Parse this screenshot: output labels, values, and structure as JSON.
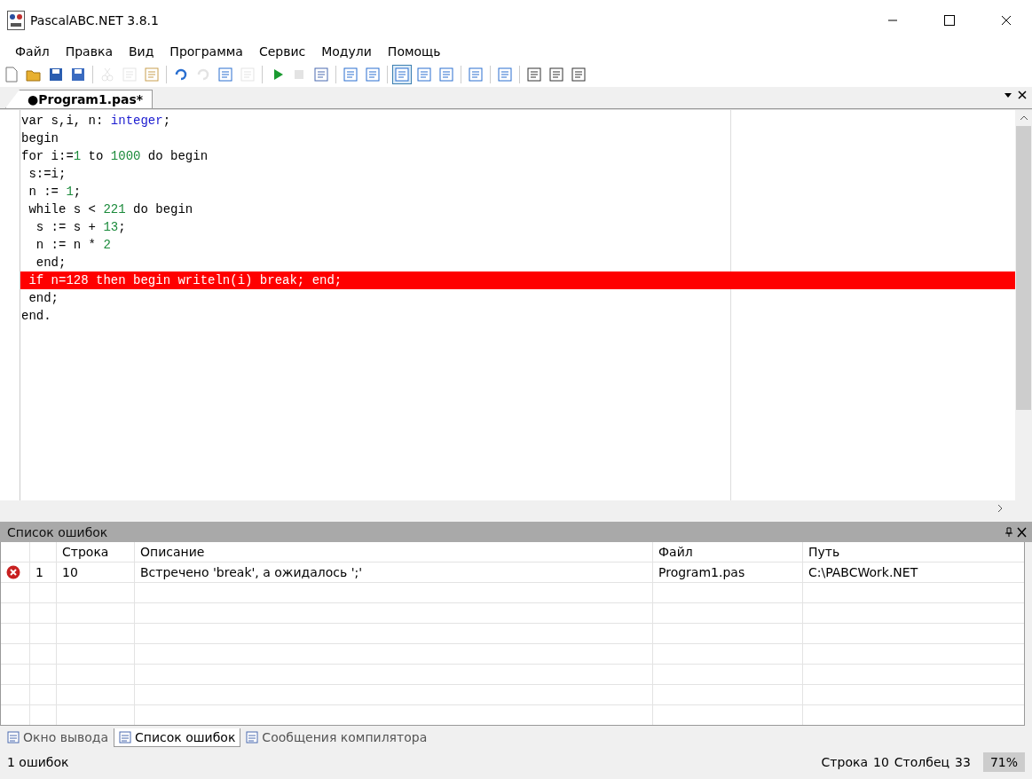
{
  "window": {
    "title": "PascalABC.NET 3.8.1"
  },
  "menu": [
    "Файл",
    "Правка",
    "Вид",
    "Программа",
    "Сервис",
    "Модули",
    "Помощь"
  ],
  "toolbar": [
    {
      "kind": "new",
      "disabled": false,
      "pressed": false
    },
    {
      "kind": "open",
      "disabled": false,
      "pressed": false
    },
    {
      "kind": "save",
      "disabled": false,
      "pressed": false
    },
    {
      "kind": "saveall",
      "disabled": false,
      "pressed": false
    },
    {
      "kind": "sep"
    },
    {
      "kind": "cut",
      "disabled": true,
      "pressed": false
    },
    {
      "kind": "copy",
      "disabled": true,
      "pressed": false
    },
    {
      "kind": "paste",
      "disabled": false,
      "pressed": false
    },
    {
      "kind": "sep"
    },
    {
      "kind": "undo",
      "disabled": false,
      "pressed": false
    },
    {
      "kind": "redo",
      "disabled": true,
      "pressed": false
    },
    {
      "kind": "back",
      "disabled": false,
      "pressed": false
    },
    {
      "kind": "forward",
      "disabled": true,
      "pressed": false
    },
    {
      "kind": "sep"
    },
    {
      "kind": "run",
      "disabled": false,
      "pressed": false
    },
    {
      "kind": "stop",
      "disabled": true,
      "pressed": false
    },
    {
      "kind": "build",
      "disabled": false,
      "pressed": false
    },
    {
      "kind": "sep"
    },
    {
      "kind": "stepin",
      "disabled": false,
      "pressed": false
    },
    {
      "kind": "stepover",
      "disabled": false,
      "pressed": false
    },
    {
      "kind": "sep"
    },
    {
      "kind": "console",
      "disabled": false,
      "pressed": true
    },
    {
      "kind": "cursor",
      "disabled": false,
      "pressed": false
    },
    {
      "kind": "abc",
      "disabled": false,
      "pressed": false
    },
    {
      "kind": "sep"
    },
    {
      "kind": "format",
      "disabled": false,
      "pressed": false
    },
    {
      "kind": "sep"
    },
    {
      "kind": "code",
      "disabled": false,
      "pressed": false
    },
    {
      "kind": "sep"
    },
    {
      "kind": "docd",
      "disabled": false,
      "pressed": false
    },
    {
      "kind": "docl",
      "disabled": false,
      "pressed": false
    },
    {
      "kind": "docr",
      "disabled": false,
      "pressed": false
    }
  ],
  "doc_tabs": [
    {
      "label": "●Program1.pas*",
      "selected": true
    }
  ],
  "code": [
    {
      "highlighted": false,
      "tokens": [
        {
          "t": "var s,i, n: ",
          "kind": "plain"
        },
        {
          "t": "integer",
          "kind": "type"
        },
        {
          "t": ";",
          "kind": "plain"
        }
      ]
    },
    {
      "highlighted": false,
      "tokens": [
        {
          "t": "begin",
          "kind": "plain"
        }
      ]
    },
    {
      "highlighted": false,
      "tokens": [
        {
          "t": "for i:=",
          "kind": "plain"
        },
        {
          "t": "1",
          "kind": "number"
        },
        {
          "t": " to ",
          "kind": "plain"
        },
        {
          "t": "1000",
          "kind": "number"
        },
        {
          "t": " do begin",
          "kind": "plain"
        }
      ]
    },
    {
      "highlighted": false,
      "tokens": [
        {
          "t": " s:=i;",
          "kind": "plain"
        }
      ]
    },
    {
      "highlighted": false,
      "tokens": [
        {
          "t": " n := ",
          "kind": "plain"
        },
        {
          "t": "1",
          "kind": "number"
        },
        {
          "t": ";",
          "kind": "plain"
        }
      ]
    },
    {
      "highlighted": false,
      "tokens": [
        {
          "t": " while s < ",
          "kind": "plain"
        },
        {
          "t": "221",
          "kind": "number"
        },
        {
          "t": " do begin",
          "kind": "plain"
        }
      ]
    },
    {
      "highlighted": false,
      "tokens": [
        {
          "t": "  s := s + ",
          "kind": "plain"
        },
        {
          "t": "13",
          "kind": "number"
        },
        {
          "t": ";",
          "kind": "plain"
        }
      ]
    },
    {
      "highlighted": false,
      "tokens": [
        {
          "t": "  n := n * ",
          "kind": "plain"
        },
        {
          "t": "2",
          "kind": "number"
        }
      ]
    },
    {
      "highlighted": false,
      "tokens": [
        {
          "t": "  end;",
          "kind": "plain"
        }
      ]
    },
    {
      "highlighted": true,
      "tokens": [
        {
          "t": " if n=128 then begin writeln(i) ",
          "kind": "plain"
        },
        {
          "t": "break; end;",
          "kind": "plain"
        }
      ]
    },
    {
      "highlighted": false,
      "tokens": [
        {
          "t": " end;",
          "kind": "plain"
        }
      ]
    },
    {
      "highlighted": false,
      "tokens": [
        {
          "t": "end.",
          "kind": "plain"
        }
      ]
    }
  ],
  "error_panel": {
    "title": "Список ошибок",
    "columns": [
      "Строка",
      "Описание",
      "Файл",
      "Путь"
    ],
    "rows": [
      {
        "index": "1",
        "line": "10",
        "description": "Встречено 'break', а ожидалось ';'",
        "file": "Program1.pas",
        "path": "C:\\PABCWork.NET"
      }
    ]
  },
  "bottom_tabs": [
    {
      "label": "Окно вывода",
      "selected": false
    },
    {
      "label": "Список ошибок",
      "selected": true
    },
    {
      "label": "Сообщения компилятора",
      "selected": false
    }
  ],
  "status_bar": {
    "message": "1 ошибок",
    "line_label": "Строка",
    "line": "10",
    "col_label": "Столбец",
    "col": "33",
    "zoom": "71%"
  }
}
